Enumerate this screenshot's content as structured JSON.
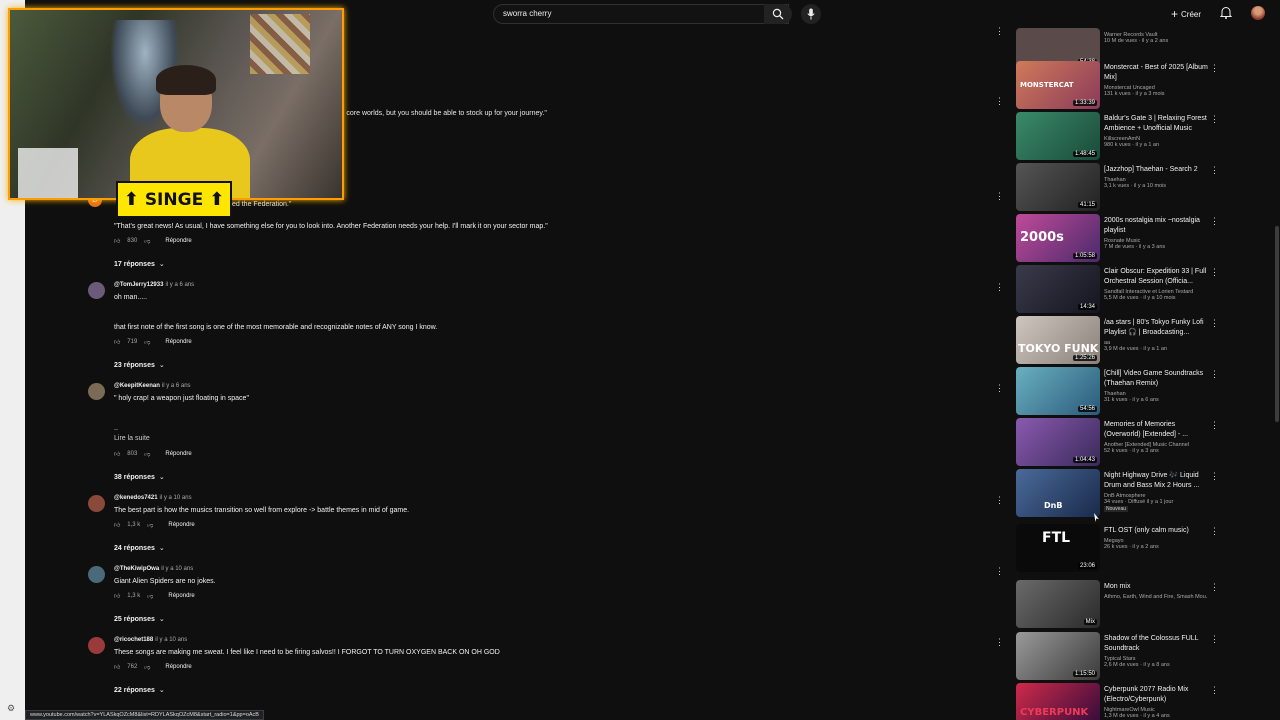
{
  "search": {
    "value": "sworra cherry"
  },
  "header": {
    "create_label": "Créer"
  },
  "webcam": {
    "badge_text": "SINGE"
  },
  "partials": {
    "line1": "gi core worlds, but you should be able to stock up for your journey.\"",
    "line2": "ed the Federation.\""
  },
  "comments": [
    {
      "user": "",
      "age": "",
      "text": "\"That's great news! As usual, I have something else for you to look into. Another Federation needs your help. I'll mark it on your sector map.\"",
      "likes": "830",
      "reply": "Répondre",
      "replies": "17 réponses",
      "avatar_letter": "D",
      "avatar_color": "#e0711a"
    },
    {
      "user": "@TomJerry12933",
      "age": "il y a 6 ans",
      "text": "oh man.....\n\n\nthat first note of the first song is one of the most memorable and recognizable notes of ANY song I know.",
      "likes": "719",
      "reply": "Répondre",
      "replies": "23 réponses",
      "avatar_color": "#6b5a7a"
    },
    {
      "user": "@KeepitKeenan",
      "age": "il y a 6 ans",
      "text": "\" holy crap! a weapon just floating in space\"\n\n\n..",
      "readmore": "Lire la suite",
      "likes": "803",
      "reply": "Répondre",
      "replies": "38 réponses",
      "avatar_color": "#7b6a55"
    },
    {
      "user": "@kenedos7421",
      "age": "il y a 10 ans",
      "text": "The best part is how the musics transition so well from explore -> battle themes in mid of game.",
      "likes": "1,3 k",
      "reply": "Répondre",
      "replies": "24 réponses",
      "avatar_color": "#8a4a3a"
    },
    {
      "user": "@TheKiwipOwa",
      "age": "il y a 10 ans",
      "text": "Giant Alien Spiders are no jokes.",
      "likes": "1,3 k",
      "reply": "Répondre",
      "replies": "25 réponses",
      "avatar_color": "#4a6a7a"
    },
    {
      "user": "@ricochet188",
      "age": "il y a 10 ans",
      "text": "These songs are making me sweat. I feel like I need to be firing salvos!! I FORGOT TO TURN OXYGEN BACK ON OH GOD",
      "likes": "762",
      "reply": "Répondre",
      "replies": "22 réponses",
      "avatar_color": "#9a3a3a"
    }
  ],
  "sidebar": {
    "videos": [
      {
        "title": "",
        "channel": "Warner Records Vault",
        "views": "10 M de vues · il y a 2 ans",
        "duration": "54:38",
        "thumb_color": "#5a4a4a"
      },
      {
        "title": "Monstercat - Best of 2025 [Album Mix]",
        "channel": "Monstercat Uncaged",
        "views": "131 k vues · il y a 3 mois",
        "duration": "1:33:39",
        "thumb_color": "#c06a4a",
        "thumb_label": "MONSTERCAT"
      },
      {
        "title": "Baldur's Gate 3 | Relaxing Forest Ambience + Unofficial Music",
        "channel": "KillscreenAmN",
        "views": "980 k vues · il y a 1 an",
        "duration": "1:48:45",
        "thumb_color": "#3a7a6a"
      },
      {
        "title": "[Jazzhop] Thaehan - Search 2",
        "channel": "Thaehan",
        "views": "3,1 k vues · il y a 10 mois",
        "duration": "41:15",
        "thumb_color": "#3a3a3a"
      },
      {
        "title": "2000s nostalgia mix ~nostalgia playlist",
        "channel": "Rosnate Music",
        "views": "7 M de vues · il y a 3 ans",
        "duration": "1:05:58",
        "thumb_color": "#8a3a6a",
        "thumb_label": "2000s"
      },
      {
        "title": "Clair Obscur: Expedition 33 | Full Orchestral Session (Officia...",
        "channel": "Sandfall Interactive et Lorien Testard",
        "views": "5,5 M de vues · il y a 10 mois",
        "duration": "14:34",
        "thumb_color": "#2a2a3a"
      },
      {
        "title": "/aa stars | 80's Tokyo Funky Lofi Playlist 🎧 | Broadcasting...",
        "channel": "aa",
        "views": "3,9 M de vues · il y a 1 an",
        "duration": "1:25:26",
        "thumb_color": "#b0a6a0",
        "thumb_label": "TOKYO FUNK"
      },
      {
        "title": "[Chill] Video Game Soundtracks (Thaehan Remix)",
        "channel": "Thaehan",
        "views": "31 k vues · il y a 6 ans",
        "duration": "54:56",
        "thumb_color": "#4a7a8a"
      },
      {
        "title": "Memories of Memories (Overworld) [Extended] - ...",
        "channel": "Another [Extended] Music Channel",
        "views": "52 k vues · il y a 3 ans",
        "duration": "1:04:43",
        "thumb_color": "#6a4a8a"
      },
      {
        "title": "Night Highway Drive 🎶 Liquid Drum and Bass Mix 2 Hours ...",
        "channel": "DnB Atmosphere",
        "views": "34 vues · Diffusé il y a 1 jour",
        "badge": "Nouveau",
        "duration": "",
        "thumb_color": "#2a3a5a",
        "thumb_label": "DnB"
      },
      {
        "title": "FTL OST (only calm music)",
        "channel": "Megayo",
        "views": "26 k vues · il y a 2 ans",
        "duration": "23:06",
        "thumb_color": "#0a0a0a",
        "thumb_label": "FTL"
      },
      {
        "title": "Mon mix",
        "channel": "Athmo, Earth, Wind and Fire, Smash Mou...",
        "views": "",
        "duration": "Mix",
        "thumb_color": "#4a4a4a"
      },
      {
        "title": "Shadow of the Colossus FULL Soundtrack",
        "channel": "Typical Stars",
        "views": "2,6 M de vues · il y a 8 ans",
        "duration": "1:15:50",
        "thumb_color": "#6a6a6a"
      },
      {
        "title": "Cyberpunk 2077 Radio Mix (Electro/Cyberpunk)",
        "channel": "NightmareOwl Music",
        "views": "1,3 M de vues · il y a 4 ans",
        "duration": "",
        "thumb_color": "#6a1a2a",
        "thumb_label": "CYBERPUNK"
      }
    ]
  },
  "statusbar": {
    "url": "www.youtube.com/watch?v=YLASkqOZcM8&list=RDYLASkqOZcM8&start_radio=1&pp=oAcB"
  }
}
